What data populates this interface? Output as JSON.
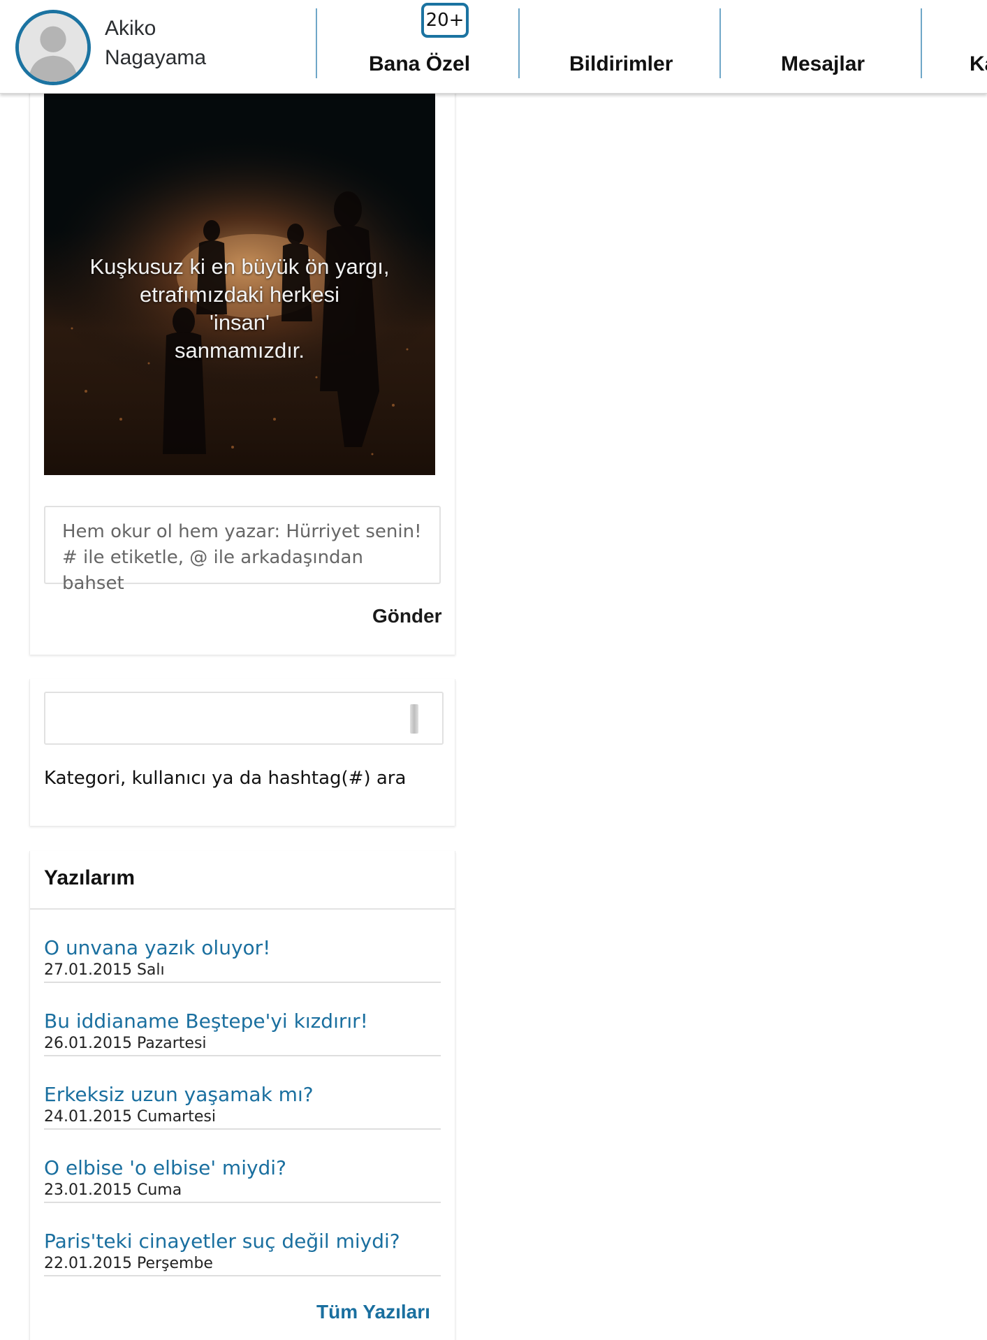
{
  "header": {
    "username": "Akiko Nagayama",
    "notification_badge": "20+",
    "tabs": [
      {
        "label": "Bana Özel"
      },
      {
        "label": "Bildirimler"
      },
      {
        "label": "Mesajlar"
      },
      {
        "label": "Ka"
      }
    ]
  },
  "post": {
    "quote_text": "Kuşkusuz ki en büyük ön yargı,\netrafımızdaki herkesi\n'insan'\nsanmamızdır."
  },
  "compose": {
    "placeholder": "Hem okur ol hem yazar: Hürriyet senin! # ile etiketle, @ ile arkadaşından bahset",
    "send_label": "Gönder"
  },
  "search": {
    "label": "Kategori, kullanıcı ya da hashtag(#) ara"
  },
  "my_posts": {
    "title": "Yazılarım",
    "items": [
      {
        "title": "O unvana yazık oluyor!",
        "date": "27.01.2015 Salı"
      },
      {
        "title": "Bu iddianame Beştepe'yi kızdırır!",
        "date": "26.01.2015 Pazartesi"
      },
      {
        "title": "Erkeksiz uzun yaşamak mı?",
        "date": "24.01.2015 Cumartesi"
      },
      {
        "title": "O elbise 'o elbise' miydi?",
        "date": "23.01.2015 Cuma"
      },
      {
        "title": "Paris'teki cinayetler suç değil miydi?",
        "date": "22.01.2015 Perşembe"
      }
    ],
    "all_posts_label": "Tüm Yazıları"
  },
  "icons": {
    "avatar": "default-user-silhouette-icon",
    "menu": "minus-icon",
    "search": "search-icon"
  },
  "colors": {
    "accent": "#1b73a1",
    "link": "#1a6f9f",
    "photo_background": "#050a0c"
  }
}
